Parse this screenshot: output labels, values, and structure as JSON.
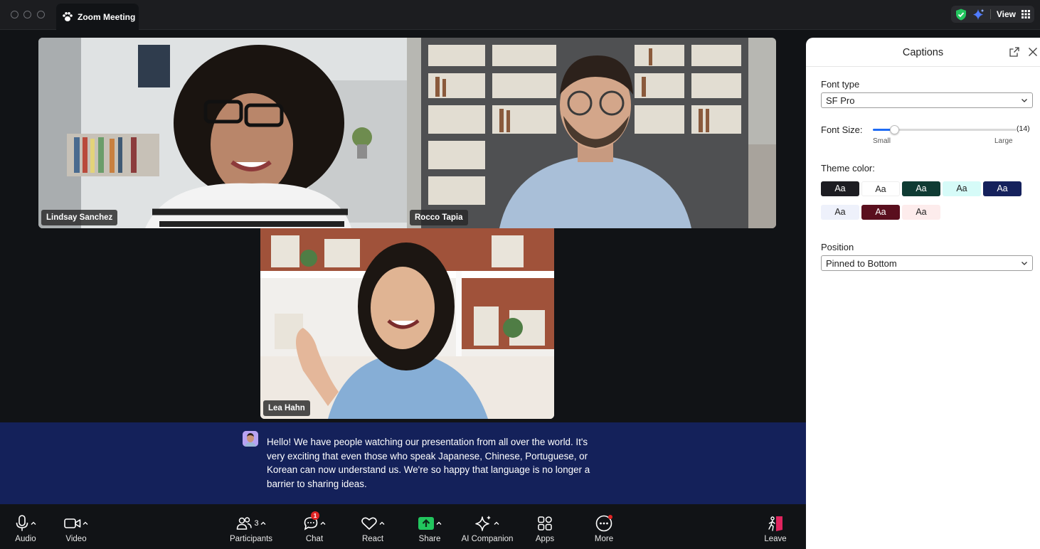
{
  "window": {
    "tab_title": "Zoom Meeting",
    "view_label": "View",
    "icons": [
      "paw-icon",
      "shield-check-icon",
      "ai-sparkle-icon",
      "grid-icon"
    ]
  },
  "participants": [
    {
      "name": "Lindsay Sanchez"
    },
    {
      "name": "Rocco Tapia"
    },
    {
      "name": "Lea Hahn"
    }
  ],
  "caption": {
    "text": "Hello! We have people watching our presentation from all over the world. It's very exciting that even those who speak Japanese, Chinese, Portuguese, or Korean can now understand us. We're so happy that language is no longer a barrier to sharing ideas."
  },
  "panel": {
    "title": "Captions",
    "font_type_label": "Font type",
    "font_type_value": "SF Pro",
    "font_size_label": "Font Size:",
    "font_size_value": "(14)",
    "font_size_level": 0.15,
    "font_size_min_label": "Small",
    "font_size_max_label": "Large",
    "theme_color_label": "Theme color:",
    "themes": [
      {
        "label": "Aa",
        "bg": "#1d1d22",
        "fg": "#ffffff",
        "selected": false
      },
      {
        "label": "Aa",
        "bg": "#ffffff",
        "fg": "#222222",
        "selected": false
      },
      {
        "label": "Aa",
        "bg": "#0f3b33",
        "fg": "#ffffff",
        "selected": false
      },
      {
        "label": "Aa",
        "bg": "#d6fbf8",
        "fg": "#222222",
        "selected": false
      },
      {
        "label": "Aa",
        "bg": "#15215c",
        "fg": "#ffffff",
        "selected": true
      },
      {
        "label": "Aa",
        "bg": "#eef1fb",
        "fg": "#222222",
        "selected": false
      },
      {
        "label": "Aa",
        "bg": "#5a0f1e",
        "fg": "#ffffff",
        "selected": false
      },
      {
        "label": "Aa",
        "bg": "#fdecec",
        "fg": "#222222",
        "selected": false
      }
    ],
    "position_label": "Position",
    "position_value": "Pinned to Bottom"
  },
  "toolbar": {
    "audio": "Audio",
    "video": "Video",
    "participants": "Participants",
    "participants_count": "3",
    "chat": "Chat",
    "chat_badge": "1",
    "react": "React",
    "share": "Share",
    "ai_companion": "AI Companion",
    "apps": "Apps",
    "more": "More",
    "leave": "Leave"
  },
  "colors": {
    "accent": "#1f6cf5",
    "share_green": "#22c55e",
    "badge_red": "#e02424",
    "caption_bg": "#14215a"
  }
}
